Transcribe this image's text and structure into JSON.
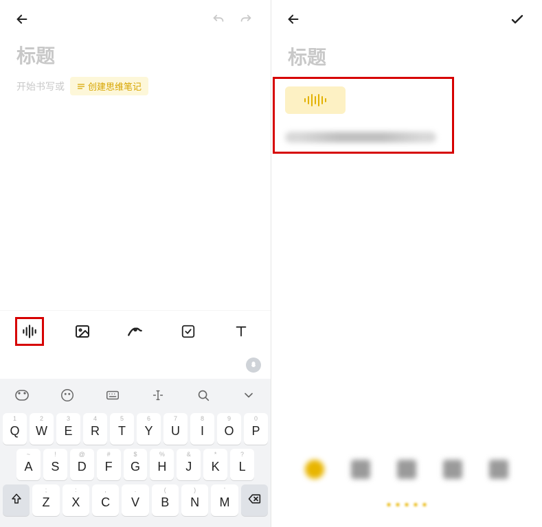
{
  "left": {
    "title": "标题",
    "prompt": "开始书写或",
    "mind_chip": "创建思维笔记",
    "toolbar": [
      {
        "id": "audio",
        "name": "audio-toolbar-icon",
        "hl": true
      },
      {
        "id": "image",
        "name": "image-toolbar-icon",
        "hl": false
      },
      {
        "id": "scribble",
        "name": "scribble-toolbar-icon",
        "hl": false
      },
      {
        "id": "checkbox",
        "name": "checkbox-toolbar-icon",
        "hl": false
      },
      {
        "id": "text",
        "name": "text-toolbar-icon",
        "hl": false
      }
    ],
    "kb_utils": [
      "du",
      "face",
      "keyboard",
      "cursor",
      "search",
      "collapse"
    ],
    "kb_rows": {
      "r1": [
        {
          "n": "1",
          "c": "Q"
        },
        {
          "n": "2",
          "c": "W"
        },
        {
          "n": "3",
          "c": "E"
        },
        {
          "n": "4",
          "c": "R"
        },
        {
          "n": "5",
          "c": "T"
        },
        {
          "n": "6",
          "c": "Y"
        },
        {
          "n": "7",
          "c": "U"
        },
        {
          "n": "8",
          "c": "I"
        },
        {
          "n": "9",
          "c": "O"
        },
        {
          "n": "0",
          "c": "P"
        }
      ],
      "r2": [
        {
          "n": "~",
          "c": "A"
        },
        {
          "n": "!",
          "c": "S"
        },
        {
          "n": "@",
          "c": "D"
        },
        {
          "n": "#",
          "c": "F"
        },
        {
          "n": "$",
          "c": "G"
        },
        {
          "n": "%",
          "c": "H"
        },
        {
          "n": "&",
          "c": "J"
        },
        {
          "n": "*",
          "c": "K"
        },
        {
          "n": "?",
          "c": "L"
        }
      ],
      "r3": [
        {
          "n": ";",
          "c": "Z"
        },
        {
          "n": ":",
          "c": "X"
        },
        {
          "n": ",",
          "c": "C"
        },
        {
          "n": ".",
          "c": "V"
        },
        {
          "n": "(",
          "c": "B"
        },
        {
          "n": ")",
          "c": "N"
        },
        {
          "n": "'",
          "c": "M"
        }
      ]
    }
  },
  "right": {
    "title": "标题",
    "blurred_text": "语音录音 将被输入成文 好了"
  }
}
